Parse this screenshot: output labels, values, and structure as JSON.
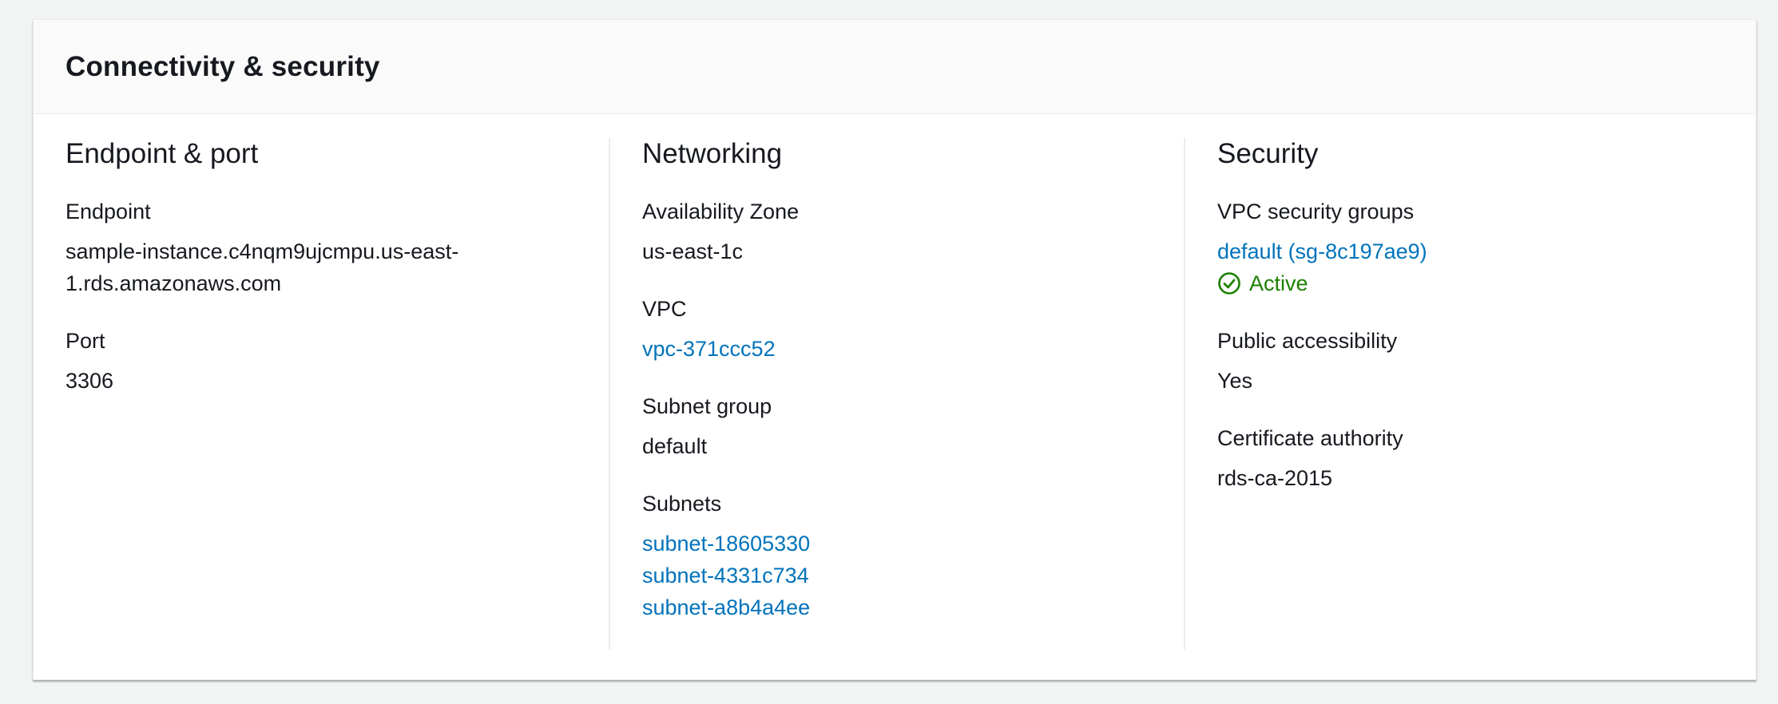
{
  "panel": {
    "title": "Connectivity & security"
  },
  "endpoint_port": {
    "title": "Endpoint & port",
    "endpoint_label": "Endpoint",
    "endpoint_line1": "sample-instance.c4nqm9ujcmpu.us-east-",
    "endpoint_line2": "1.rds.amazonaws.com",
    "port_label": "Port",
    "port_value": "3306"
  },
  "networking": {
    "title": "Networking",
    "az_label": "Availability Zone",
    "az_value": "us-east-1c",
    "vpc_label": "VPC",
    "vpc_value": "vpc-371ccc52",
    "subnet_group_label": "Subnet group",
    "subnet_group_value": "default",
    "subnets_label": "Subnets",
    "subnets": [
      "subnet-18605330",
      "subnet-4331c734",
      "subnet-a8b4a4ee"
    ]
  },
  "security": {
    "title": "Security",
    "sg_label": "VPC security groups",
    "sg_value": "default (sg-8c197ae9)",
    "sg_status": "Active",
    "public_label": "Public accessibility",
    "public_value": "Yes",
    "ca_label": "Certificate authority",
    "ca_value": "rds-ca-2015"
  },
  "colors": {
    "link": "#0073bb",
    "success": "#1d8102",
    "text": "#16191f",
    "divider": "#eaeded"
  },
  "icons": {
    "status": "check-circle-icon"
  }
}
